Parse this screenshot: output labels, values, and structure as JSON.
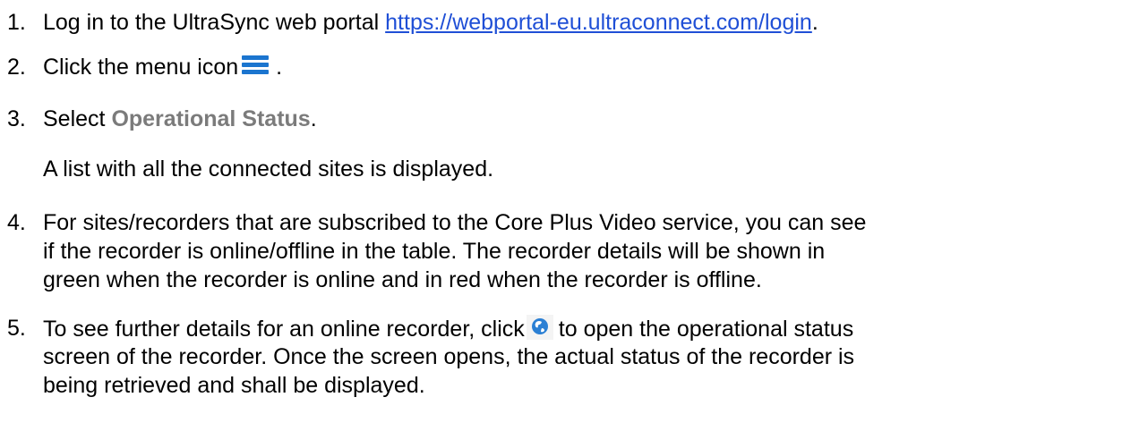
{
  "steps": [
    {
      "number": "1.",
      "before": "Log in to the UltraSync web portal ",
      "link": "https://webportal-eu.ultraconnect.com/login",
      "after": "."
    },
    {
      "number": "2.",
      "before": "Click the menu icon",
      "icon": "hamburger-menu-icon",
      "after": "."
    },
    {
      "number": "3.",
      "before": "Select ",
      "bold": "Operational Status",
      "after": ".",
      "note": "A list with all the connected sites is displayed."
    },
    {
      "number": "4.",
      "lines": [
        "For sites/recorders that are subscribed to the Core Plus Video service, you can see",
        "if the recorder is online/offline in the table. The recorder details will be shown in",
        "green when the recorder is online and in red when the recorder is offline."
      ]
    },
    {
      "number": "5.",
      "line1_before": "To see further details for an online recorder, click",
      "icon": "globe-icon",
      "line1_after": "to open the operational status",
      "lines": [
        "screen of the recorder. Once the screen opens, the actual status of the recorder is",
        "being retrieved and shall be displayed."
      ]
    }
  ],
  "colors": {
    "link": "#1f4fd6",
    "bold_label": "#7b7b7b",
    "menu_icon": "#1b75cf",
    "globe_icon": "#2a7fd4"
  }
}
